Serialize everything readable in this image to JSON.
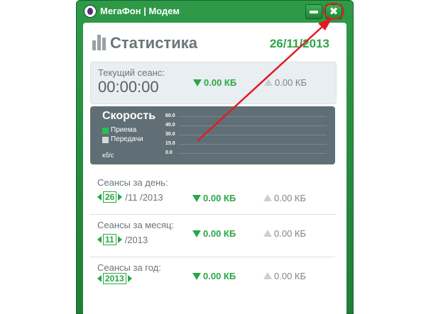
{
  "window": {
    "title": "МегаФон | Модем"
  },
  "header": {
    "title": "Статистика",
    "date": "26/11/2013"
  },
  "current_session": {
    "label": "Текущий сеанс:",
    "time": "00:00:00",
    "received": "0.00 КБ",
    "sent": "0.00 КБ"
  },
  "speed": {
    "title": "Скорость",
    "legend": {
      "receive": "Приема",
      "send": "Передачи"
    },
    "unit": "кб/с",
    "y_ticks": [
      "60.0",
      "45.0",
      "30.0",
      "15.0",
      "0.0"
    ]
  },
  "sessions": [
    {
      "label": "Сеансы за день:",
      "picker_value": "26",
      "picker_rest": "/11 /2013",
      "received": "0.00 КБ",
      "sent": "0.00 КБ"
    },
    {
      "label": "Сеансы за месяц:",
      "picker_value": "11",
      "picker_rest": "/2013",
      "received": "0.00 КБ",
      "sent": "0.00 КБ"
    },
    {
      "label": "Сеансы за год:",
      "picker_value": "2013",
      "picker_rest": "",
      "received": "0.00 КБ",
      "sent": "0.00 КБ"
    }
  ],
  "colors": {
    "brand_green": "#29a845",
    "titlebar_green": "#2e9a48",
    "speed_panel": "#5f6f75",
    "annotation_red": "#e11b22"
  },
  "icons": {
    "logo": "megafon-logo-icon",
    "minimize": "minimize-icon",
    "close": "close-icon",
    "stats": "bar-chart-icon",
    "download": "download-arrow-icon",
    "upload": "upload-arrow-icon"
  }
}
